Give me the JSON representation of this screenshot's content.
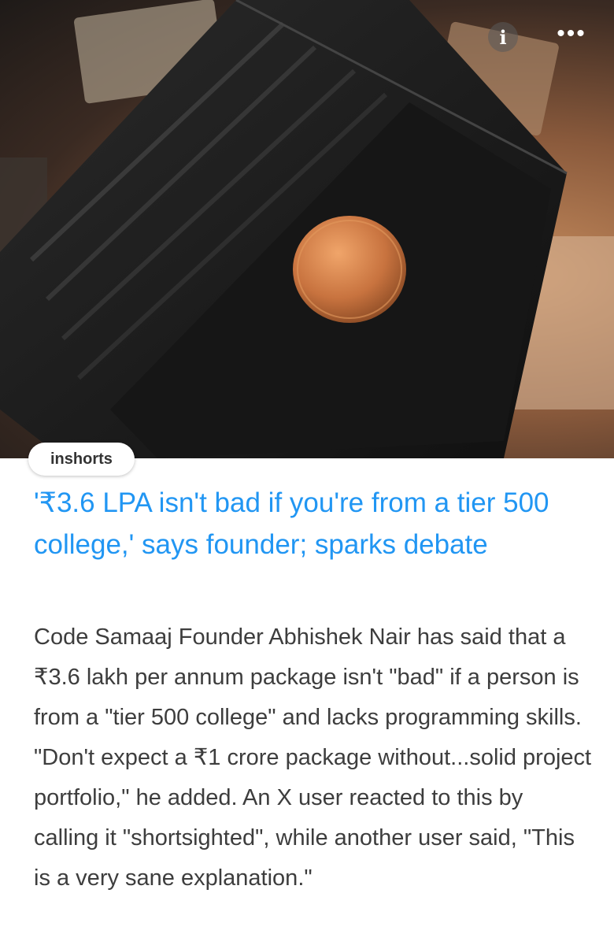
{
  "hero": {
    "image_alt": "black leather wallet with a single coin on rupee notes",
    "info_icon": "info-icon",
    "more_icon": "more-dots-icon",
    "info_label": "i",
    "more_label": "•••"
  },
  "source": {
    "label": "inshorts"
  },
  "article": {
    "headline": "'₹3.6 LPA isn't bad if you're from a tier 500 college,' says founder; sparks debate",
    "body": "Code Samaaj Founder Abhishek Nair has said that a ₹3.6 lakh per annum package isn't \"bad\" if a person is from a \"tier 500 college\" and lacks programming skills. \"Don't expect a ₹1 crore package without...solid project portfolio,\" he added. An X user reacted to this by calling it \"shortsighted\", while another user said, \"This is a very sane explanation.\""
  },
  "colors": {
    "headline": "#2196f3",
    "body": "#3d3d3d",
    "background": "#ffffff"
  }
}
